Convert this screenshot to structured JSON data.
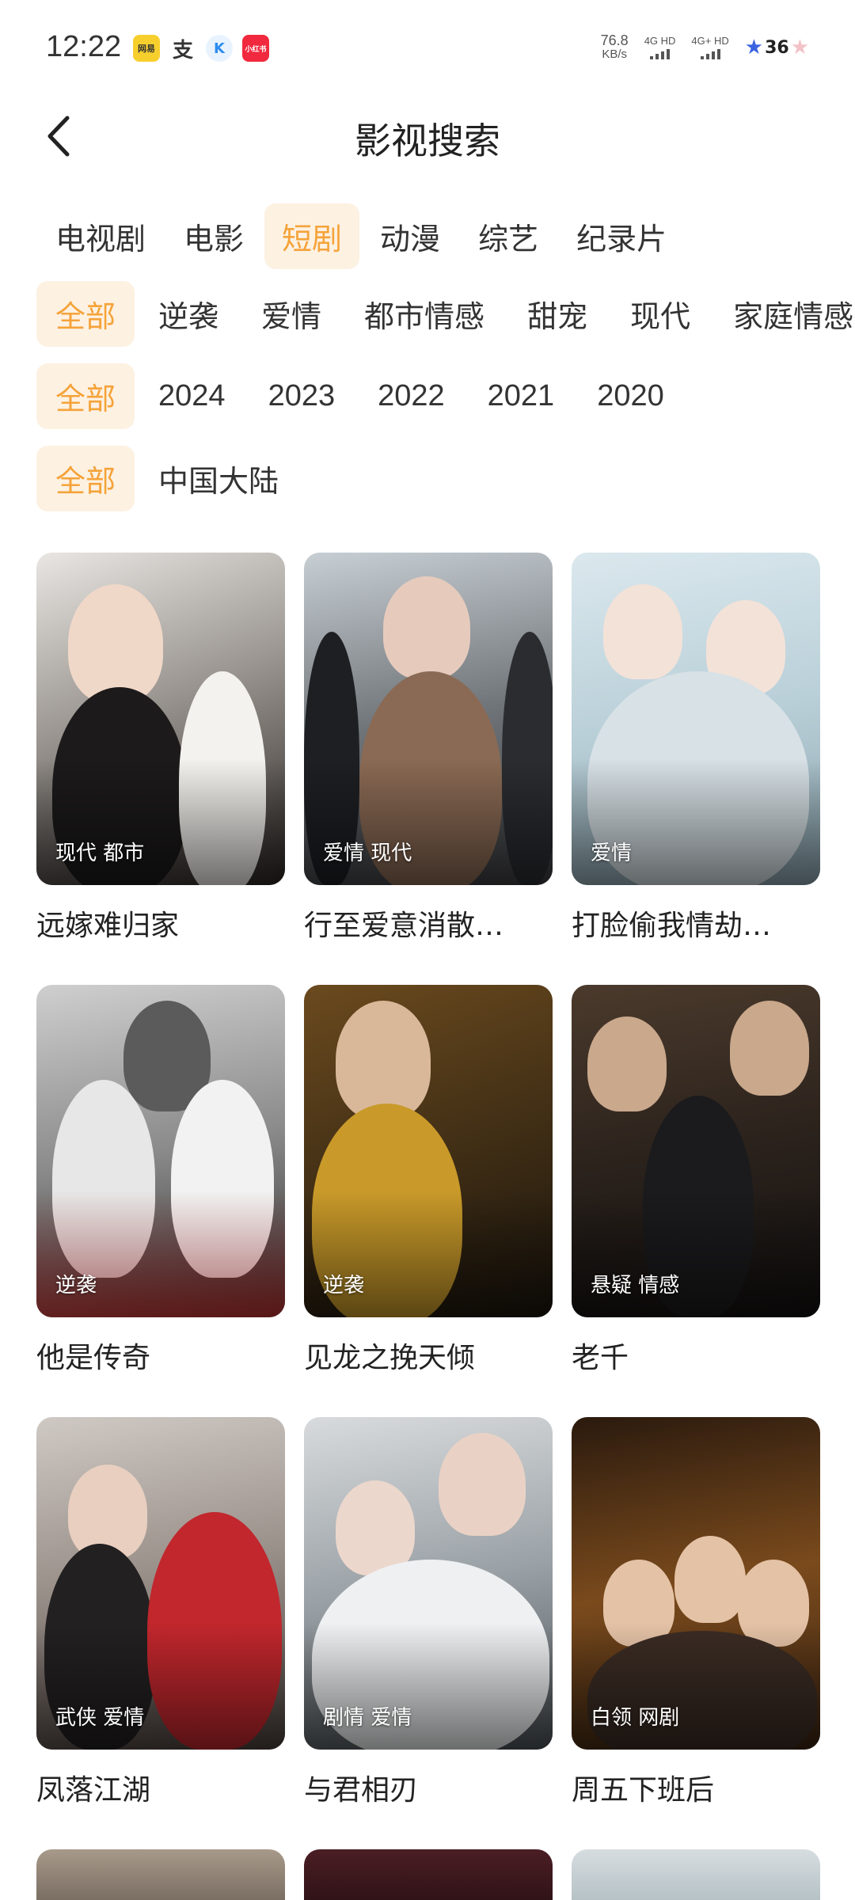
{
  "status_bar": {
    "time": "12:22",
    "apps": [
      {
        "name": "app-badge-yellow",
        "text": "网易",
        "color": "#f7cf2d"
      },
      {
        "name": "app-badge-alipay",
        "text": "支",
        "color": "#ffffff"
      },
      {
        "name": "app-badge-k",
        "text": "K",
        "color": "#e8f3ff"
      },
      {
        "name": "app-badge-red",
        "text": "小红书",
        "color": "#f1293e"
      }
    ],
    "speed_value": "76.8",
    "speed_unit": "KB/s",
    "net1": "4G HD",
    "net2": "4G+ HD",
    "battery": "36"
  },
  "header": {
    "title": "影视搜索",
    "back_icon": "chevron-left-icon"
  },
  "categories": {
    "items": [
      "电视剧",
      "电影",
      "短剧",
      "动漫",
      "综艺",
      "纪录片"
    ],
    "active_index": 2
  },
  "filters": {
    "genre": [
      "全部",
      "逆袭",
      "爱情",
      "都市情感",
      "甜宠",
      "现代",
      "家庭情感"
    ],
    "year": [
      "全部",
      "2024",
      "2023",
      "2022",
      "2021",
      "2020"
    ],
    "region": [
      "全部",
      "中国大陆"
    ]
  },
  "colors": {
    "accent": "#f5a33a",
    "accent_bg": "#fdf1e2"
  },
  "items": [
    {
      "title": "远嫁难归家",
      "tags": "现代 都市"
    },
    {
      "title": "行至爱意消散…",
      "tags": "爱情 现代"
    },
    {
      "title": "打脸偷我情劫…",
      "tags": "爱情"
    },
    {
      "title": "他是传奇",
      "tags": "逆袭"
    },
    {
      "title": "见龙之挽天倾",
      "tags": "逆袭"
    },
    {
      "title": "老千",
      "tags": "悬疑 情感"
    },
    {
      "title": "凤落江湖",
      "tags": "武侠 爱情"
    },
    {
      "title": "与君相刃",
      "tags": "剧情 爱情"
    },
    {
      "title": "周五下班后",
      "tags": "白领 网剧"
    }
  ]
}
